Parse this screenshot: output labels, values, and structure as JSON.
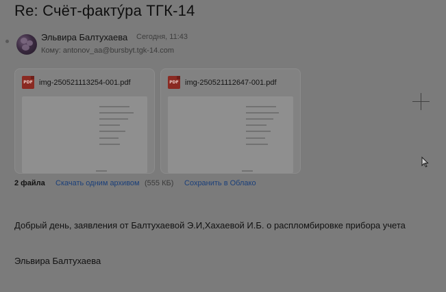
{
  "message": {
    "subject": "Re: Счёт-фактýра ТГК-14",
    "sender_name": "Эльвира Балтухаева",
    "date": "Сегодня, 11:43",
    "to_label": "Кому:",
    "to_address": "antonov_aa@bursbyt.tgk-14.com"
  },
  "attachments": {
    "items": [
      {
        "name": "img-250521113254-001.pdf",
        "type_icon": "pdf-icon",
        "badge": "PDF"
      },
      {
        "name": "img-250521112647-001.pdf",
        "type_icon": "pdf-icon",
        "badge": "PDF"
      }
    ],
    "count_label": "2 файла",
    "download_archive_label": "Скачать одним архивом",
    "archive_size": "(555 КБ)",
    "save_cloud_label": "Сохранить в Облако"
  },
  "body": {
    "text": "Добрый день, заявления от Балтухаевой Э.И,Хахаевой И.Б. о распломбировке прибора учета",
    "signature": "Эльвира Балтухаева"
  },
  "icons": {
    "add": "plus-icon",
    "cursor": "mouse-pointer-icon",
    "attachment_type": "pdf-icon"
  },
  "colors": {
    "link": "#1a3f7a",
    "pdf_badge": "#8a2a22",
    "overlay_background": "#7b7b7b"
  }
}
